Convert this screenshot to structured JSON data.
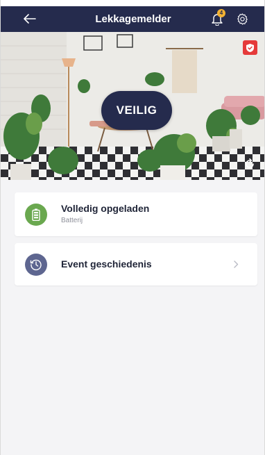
{
  "header": {
    "title": "Lekkagemelder",
    "notification_count": "4",
    "icons": {
      "back": "arrow-left-icon",
      "notifications": "bell-icon",
      "settings": "gear-icon"
    }
  },
  "hero": {
    "status_label": "VEILIG",
    "icons": {
      "armed": "shield-check-icon",
      "camera": "camera-rotate-icon"
    }
  },
  "cards": [
    {
      "title": "Volledig opgeladen",
      "subtitle": "Batterij",
      "icon": "battery-icon"
    },
    {
      "title": "Event geschiedenis",
      "icon": "history-clock-icon",
      "chevron": "chevron-right-icon"
    }
  ],
  "colors": {
    "header_bg": "#252b4d",
    "status_pill": "#252b4d",
    "battery_icon_bg": "#6aa84f",
    "history_icon_bg": "#5e6690",
    "badge": "#f2b233",
    "shield": "#e53a3a",
    "content_bg": "#f4f4f6"
  }
}
